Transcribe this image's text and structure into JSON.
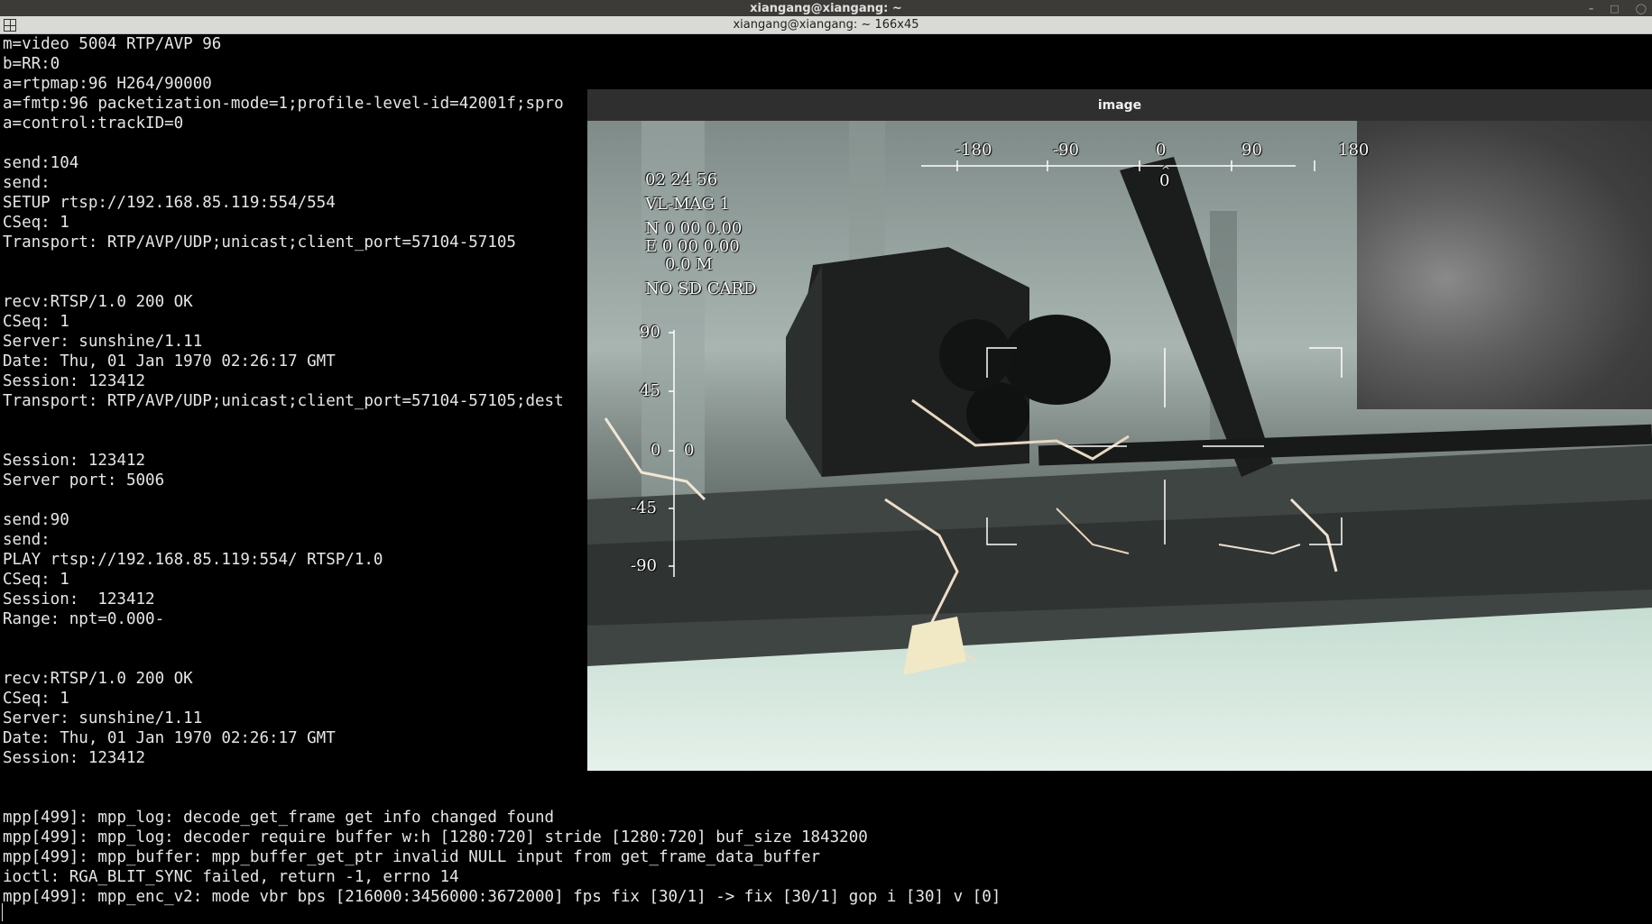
{
  "terminal": {
    "window_title": "xiangang@xiangang: ~",
    "tab_title": "xiangang@xiangang: ~ 166x45",
    "lines": [
      "m=video 5004 RTP/AVP 96",
      "b=RR:0",
      "a=rtpmap:96 H264/90000",
      "a=fmtp:96 packetization-mode=1;profile-level-id=42001f;spro",
      "a=control:trackID=0",
      "",
      "send:104",
      "send:",
      "SETUP rtsp://192.168.85.119:554/554",
      "CSeq: 1",
      "Transport: RTP/AVP/UDP;unicast;client_port=57104-57105",
      "",
      "",
      "recv:RTSP/1.0 200 OK",
      "CSeq: 1",
      "Server: sunshine/1.11",
      "Date: Thu, 01 Jan 1970 02:26:17 GMT",
      "Session: 123412",
      "Transport: RTP/AVP/UDP;unicast;client_port=57104-57105;dest",
      "",
      "",
      "Session: 123412",
      "Server port: 5006",
      "",
      "send:90",
      "send:",
      "PLAY rtsp://192.168.85.119:554/ RTSP/1.0",
      "CSeq: 1",
      "Session:  123412",
      "Range: npt=0.000-",
      "",
      "",
      "recv:RTSP/1.0 200 OK",
      "CSeq: 1",
      "Server: sunshine/1.11",
      "Date: Thu, 01 Jan 1970 02:26:17 GMT",
      "Session: 123412",
      "",
      "",
      "mpp[499]: mpp_log: decode_get_frame get info changed found",
      "mpp[499]: mpp_log: decoder require buffer w:h [1280:720] stride [1280:720] buf_size 1843200",
      "mpp[499]: mpp_buffer: mpp_buffer_get_ptr invalid NULL input from get_frame_data_buffer",
      "ioctl: RGA_BLIT_SYNC failed, return -1, errno 14",
      "mpp[499]: mpp_enc_v2: mode vbr bps [216000:3456000:3672000] fps fix [30/1] -> fix [30/1] gop i [30] v [0]"
    ]
  },
  "image_window": {
    "title": "image",
    "osd": {
      "heading_scale": [
        "-180",
        "-90",
        "0",
        "90",
        "180"
      ],
      "heading_value": "0",
      "heading_marker": "^",
      "time": "02 24 56",
      "mag": "VL-MAG 1",
      "north": "N 0 00 0.00",
      "east": "E 0 00 0.00",
      "altitude": "0.0 M",
      "sd_status": "NO SD CARD",
      "pitch_scale": [
        "90",
        "45",
        "0",
        "-45",
        "-90"
      ],
      "pitch_value": "0"
    }
  }
}
